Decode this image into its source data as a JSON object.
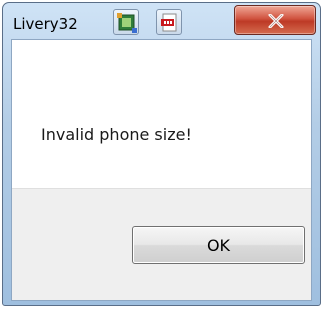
{
  "window": {
    "title": "Livery32",
    "taskbar_icons": [
      "image-editor-icon",
      "pdf-icon"
    ],
    "close_glyph": "x"
  },
  "dialog": {
    "message": "Invalid phone size!",
    "ok_label": "OK"
  },
  "colors": {
    "titlebar": "#b3cde6",
    "close_button": "#c8442f",
    "footer": "#efefef"
  }
}
